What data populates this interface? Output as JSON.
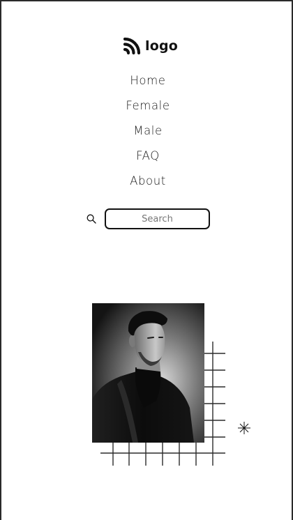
{
  "brand": {
    "logo_text": "logo",
    "logo_icon": "signal-arcs-icon"
  },
  "nav": {
    "items": [
      {
        "label": "Home"
      },
      {
        "label": "Female"
      },
      {
        "label": "Male"
      },
      {
        "label": "FAQ"
      },
      {
        "label": "About"
      }
    ]
  },
  "search": {
    "icon": "search-icon",
    "placeholder": "Search",
    "value": ""
  },
  "hero": {
    "image": "portrait-photo",
    "decorations": [
      "grid-pattern",
      "sparkle-icon"
    ]
  },
  "colors": {
    "text": "#111111",
    "border": "#2a2a2a",
    "background": "#ffffff"
  }
}
